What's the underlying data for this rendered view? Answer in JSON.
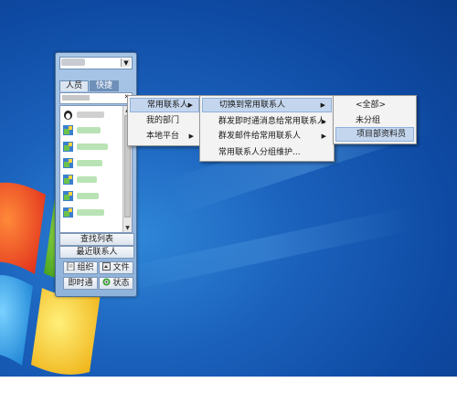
{
  "widget": {
    "tabs": [
      {
        "label": "人员"
      },
      {
        "label": "快捷"
      }
    ],
    "expand_label": "»",
    "buttons": {
      "find_list": "查找列表",
      "recent_contacts": "最近联系人",
      "org": "组织",
      "file": "文件",
      "instant": "即时通",
      "status": "状态"
    }
  },
  "menu1": {
    "items": [
      {
        "label": "常用联系人"
      },
      {
        "label": "我的部门"
      },
      {
        "label": "本地平台"
      }
    ]
  },
  "menu2": {
    "items": [
      {
        "label": "切换到常用联系人"
      },
      {
        "label": "群发即时通消息给常用联系人"
      },
      {
        "label": "群发邮件给常用联系人"
      },
      {
        "label": "常用联系人分组维护..."
      }
    ]
  },
  "menu3": {
    "items": [
      {
        "label": "<全部>"
      },
      {
        "label": "未分组"
      },
      {
        "label": "项目部资料员"
      }
    ]
  },
  "colors": {
    "desktop": "#1b62bd",
    "menu_bg": "#f3f3f3",
    "menu_highlight": "#c4d6ee",
    "widget_frame": "#8fb3db"
  }
}
